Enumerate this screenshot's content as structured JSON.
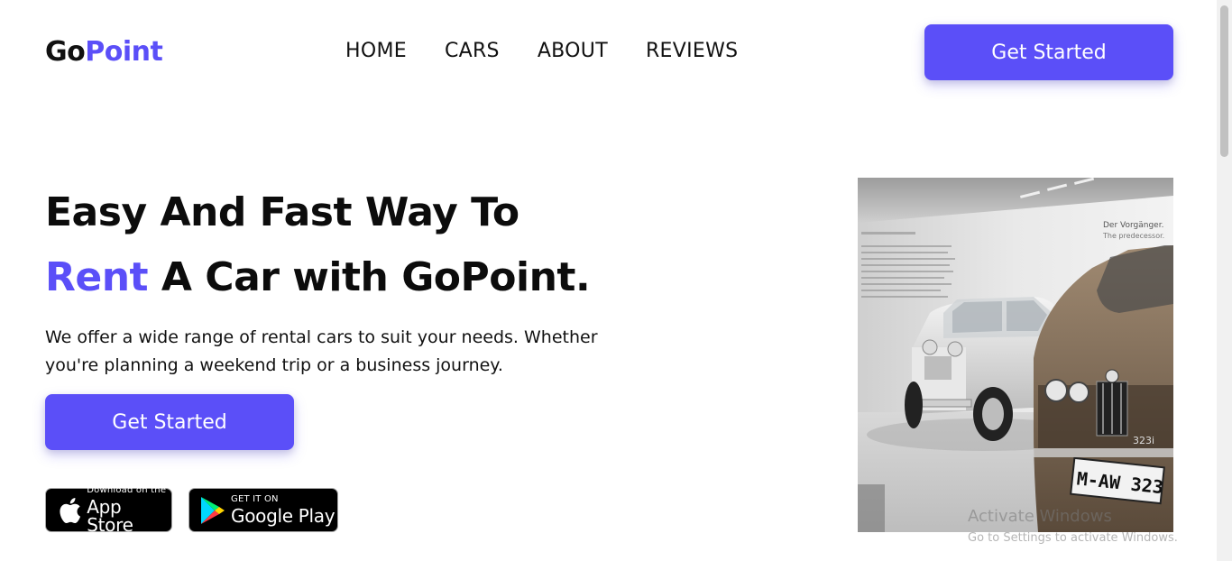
{
  "header": {
    "logo_part1": "Go",
    "logo_part2": "Point",
    "nav": [
      "HOME",
      "CARS",
      "ABOUT",
      "REVIEWS"
    ],
    "cta_label": "Get Started"
  },
  "hero": {
    "title_line1": "Easy And Fast Way To",
    "title_accent": "Rent",
    "title_line2_rest": " A Car with GoPoint.",
    "description": "We offer a wide range of rental cars to suit your needs. Whether you're planning a weekend trip or a business journey.",
    "cta_label": "Get Started"
  },
  "badges": {
    "apple": {
      "small": "Download on the",
      "big": "App Store",
      "icon": "apple-icon"
    },
    "google": {
      "small": "GET IT ON",
      "big": "Google Play",
      "icon": "google-play-icon"
    }
  },
  "image": {
    "sign_title": "Der Vorgänger.",
    "sign_subtitle": "The predecessor.",
    "plate": "M-AW 323",
    "badge_text": "323i"
  },
  "watermark": {
    "line1": "Activate Windows",
    "line2": "Go to Settings to activate Windows."
  },
  "colors": {
    "accent": "#5b4ff8",
    "text": "#111111",
    "background": "#ffffff"
  }
}
